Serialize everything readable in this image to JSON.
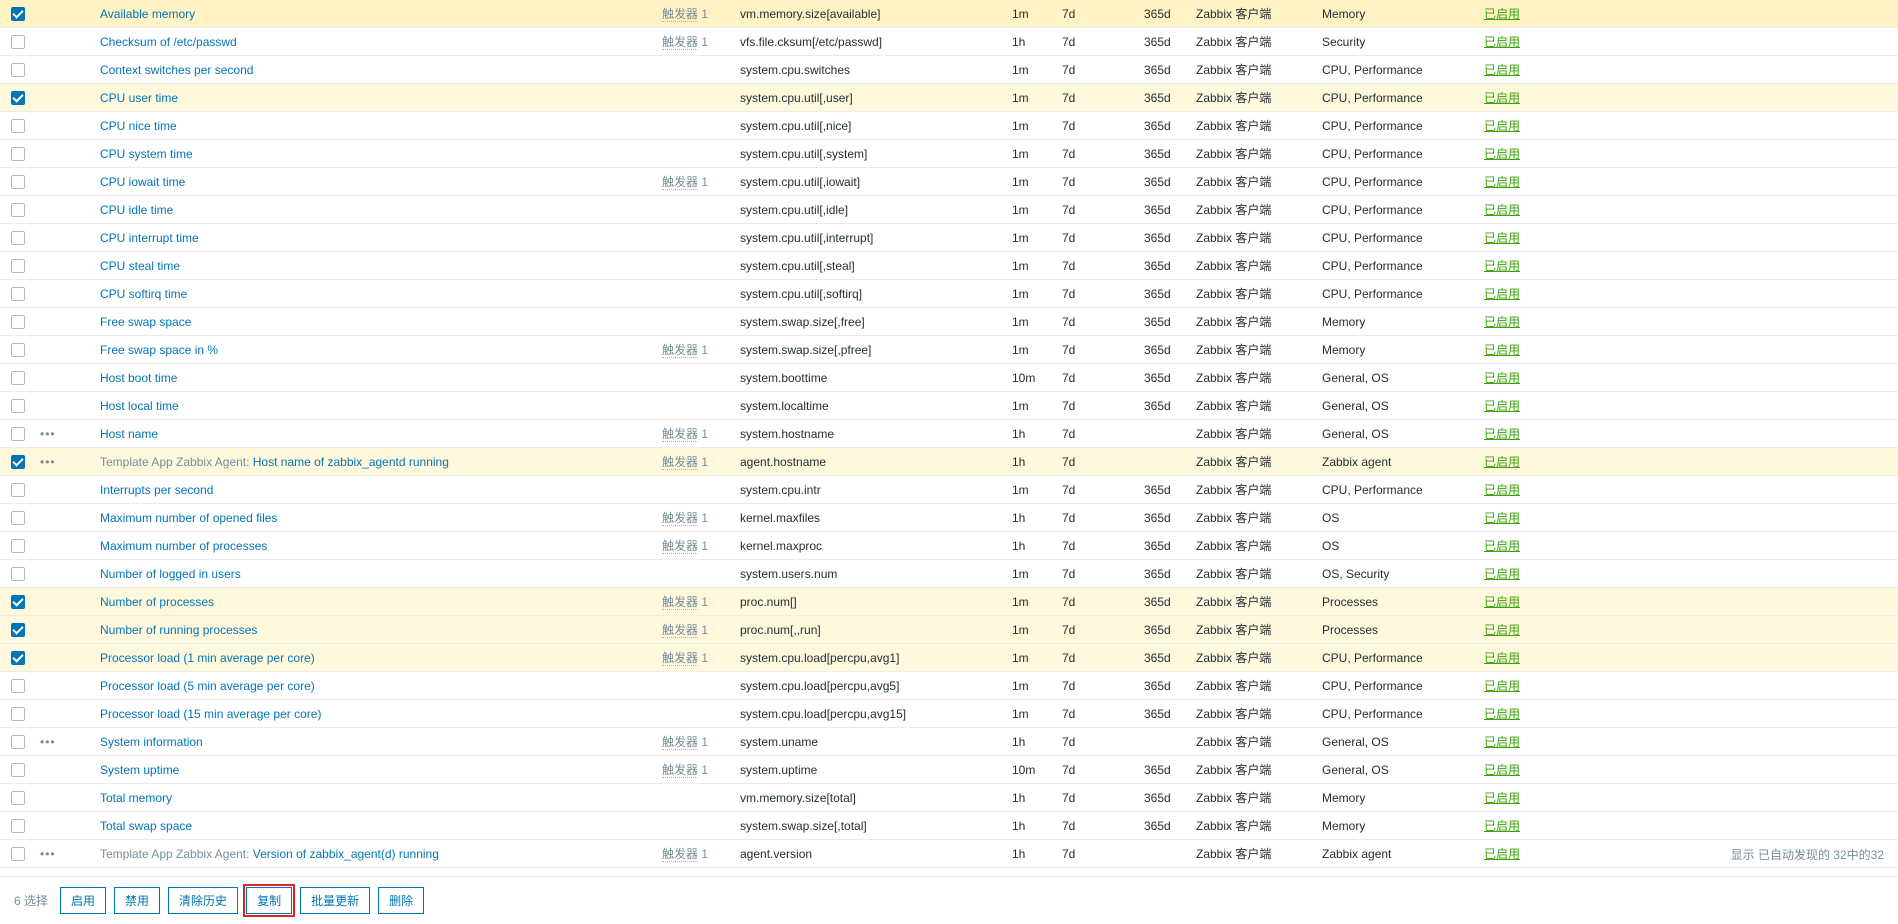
{
  "trigger_word": "触发器",
  "footer": {
    "selected_label": "6 选择",
    "enable": "启用",
    "disable": "禁用",
    "clear_history": "清除历史",
    "copy": "复制",
    "mass_update": "批量更新",
    "delete": "删除"
  },
  "summary": "显示 已自动发现的 32中的32",
  "rows": [
    {
      "checked": true,
      "wizard": "",
      "prefix": "",
      "name": "Available memory",
      "triggers": "1",
      "key": "vm.memory.size[available]",
      "interval": "1m",
      "history": "7d",
      "trends": "365d",
      "type": "Zabbix 客户端",
      "app": "Memory",
      "status": "已启用"
    },
    {
      "checked": false,
      "wizard": "",
      "prefix": "",
      "name": "Checksum of /etc/passwd",
      "triggers": "1",
      "key": "vfs.file.cksum[/etc/passwd]",
      "interval": "1h",
      "history": "7d",
      "trends": "365d",
      "type": "Zabbix 客户端",
      "app": "Security",
      "status": "已启用"
    },
    {
      "checked": false,
      "wizard": "",
      "prefix": "",
      "name": "Context switches per second",
      "triggers": "",
      "key": "system.cpu.switches",
      "interval": "1m",
      "history": "7d",
      "trends": "365d",
      "type": "Zabbix 客户端",
      "app": "CPU, Performance",
      "status": "已启用"
    },
    {
      "checked": true,
      "wizard": "",
      "prefix": "",
      "name": "CPU user time",
      "triggers": "",
      "key": "system.cpu.util[,user]",
      "interval": "1m",
      "history": "7d",
      "trends": "365d",
      "type": "Zabbix 客户端",
      "app": "CPU, Performance",
      "status": "已启用"
    },
    {
      "checked": false,
      "wizard": "",
      "prefix": "",
      "name": "CPU nice time",
      "triggers": "",
      "key": "system.cpu.util[,nice]",
      "interval": "1m",
      "history": "7d",
      "trends": "365d",
      "type": "Zabbix 客户端",
      "app": "CPU, Performance",
      "status": "已启用"
    },
    {
      "checked": false,
      "wizard": "",
      "prefix": "",
      "name": "CPU system time",
      "triggers": "",
      "key": "system.cpu.util[,system]",
      "interval": "1m",
      "history": "7d",
      "trends": "365d",
      "type": "Zabbix 客户端",
      "app": "CPU, Performance",
      "status": "已启用"
    },
    {
      "checked": false,
      "wizard": "",
      "prefix": "",
      "name": "CPU iowait time",
      "triggers": "1",
      "key": "system.cpu.util[,iowait]",
      "interval": "1m",
      "history": "7d",
      "trends": "365d",
      "type": "Zabbix 客户端",
      "app": "CPU, Performance",
      "status": "已启用"
    },
    {
      "checked": false,
      "wizard": "",
      "prefix": "",
      "name": "CPU idle time",
      "triggers": "",
      "key": "system.cpu.util[,idle]",
      "interval": "1m",
      "history": "7d",
      "trends": "365d",
      "type": "Zabbix 客户端",
      "app": "CPU, Performance",
      "status": "已启用"
    },
    {
      "checked": false,
      "wizard": "",
      "prefix": "",
      "name": "CPU interrupt time",
      "triggers": "",
      "key": "system.cpu.util[,interrupt]",
      "interval": "1m",
      "history": "7d",
      "trends": "365d",
      "type": "Zabbix 客户端",
      "app": "CPU, Performance",
      "status": "已启用"
    },
    {
      "checked": false,
      "wizard": "",
      "prefix": "",
      "name": "CPU steal time",
      "triggers": "",
      "key": "system.cpu.util[,steal]",
      "interval": "1m",
      "history": "7d",
      "trends": "365d",
      "type": "Zabbix 客户端",
      "app": "CPU, Performance",
      "status": "已启用"
    },
    {
      "checked": false,
      "wizard": "",
      "prefix": "",
      "name": "CPU softirq time",
      "triggers": "",
      "key": "system.cpu.util[,softirq]",
      "interval": "1m",
      "history": "7d",
      "trends": "365d",
      "type": "Zabbix 客户端",
      "app": "CPU, Performance",
      "status": "已启用"
    },
    {
      "checked": false,
      "wizard": "",
      "prefix": "",
      "name": "Free swap space",
      "triggers": "",
      "key": "system.swap.size[,free]",
      "interval": "1m",
      "history": "7d",
      "trends": "365d",
      "type": "Zabbix 客户端",
      "app": "Memory",
      "status": "已启用"
    },
    {
      "checked": false,
      "wizard": "",
      "prefix": "",
      "name": "Free swap space in %",
      "triggers": "1",
      "key": "system.swap.size[,pfree]",
      "interval": "1m",
      "history": "7d",
      "trends": "365d",
      "type": "Zabbix 客户端",
      "app": "Memory",
      "status": "已启用"
    },
    {
      "checked": false,
      "wizard": "",
      "prefix": "",
      "name": "Host boot time",
      "triggers": "",
      "key": "system.boottime",
      "interval": "10m",
      "history": "7d",
      "trends": "365d",
      "type": "Zabbix 客户端",
      "app": "General, OS",
      "status": "已启用"
    },
    {
      "checked": false,
      "wizard": "",
      "prefix": "",
      "name": "Host local time",
      "triggers": "",
      "key": "system.localtime",
      "interval": "1m",
      "history": "7d",
      "trends": "365d",
      "type": "Zabbix 客户端",
      "app": "General, OS",
      "status": "已启用"
    },
    {
      "checked": false,
      "wizard": "•••",
      "prefix": "",
      "name": "Host name",
      "triggers": "1",
      "key": "system.hostname",
      "interval": "1h",
      "history": "7d",
      "trends": "",
      "type": "Zabbix 客户端",
      "app": "General, OS",
      "status": "已启用"
    },
    {
      "checked": true,
      "wizard": "•••",
      "prefix": "Template App Zabbix Agent: ",
      "name": "Host name of zabbix_agentd running",
      "triggers": "1",
      "key": "agent.hostname",
      "interval": "1h",
      "history": "7d",
      "trends": "",
      "type": "Zabbix 客户端",
      "app": "Zabbix agent",
      "status": "已启用"
    },
    {
      "checked": false,
      "wizard": "",
      "prefix": "",
      "name": "Interrupts per second",
      "triggers": "",
      "key": "system.cpu.intr",
      "interval": "1m",
      "history": "7d",
      "trends": "365d",
      "type": "Zabbix 客户端",
      "app": "CPU, Performance",
      "status": "已启用"
    },
    {
      "checked": false,
      "wizard": "",
      "prefix": "",
      "name": "Maximum number of opened files",
      "triggers": "1",
      "key": "kernel.maxfiles",
      "interval": "1h",
      "history": "7d",
      "trends": "365d",
      "type": "Zabbix 客户端",
      "app": "OS",
      "status": "已启用"
    },
    {
      "checked": false,
      "wizard": "",
      "prefix": "",
      "name": "Maximum number of processes",
      "triggers": "1",
      "key": "kernel.maxproc",
      "interval": "1h",
      "history": "7d",
      "trends": "365d",
      "type": "Zabbix 客户端",
      "app": "OS",
      "status": "已启用"
    },
    {
      "checked": false,
      "wizard": "",
      "prefix": "",
      "name": "Number of logged in users",
      "triggers": "",
      "key": "system.users.num",
      "interval": "1m",
      "history": "7d",
      "trends": "365d",
      "type": "Zabbix 客户端",
      "app": "OS, Security",
      "status": "已启用"
    },
    {
      "checked": true,
      "wizard": "",
      "prefix": "",
      "name": "Number of processes",
      "triggers": "1",
      "key": "proc.num[]",
      "interval": "1m",
      "history": "7d",
      "trends": "365d",
      "type": "Zabbix 客户端",
      "app": "Processes",
      "status": "已启用"
    },
    {
      "checked": true,
      "wizard": "",
      "prefix": "",
      "name": "Number of running processes",
      "triggers": "1",
      "key": "proc.num[,,run]",
      "interval": "1m",
      "history": "7d",
      "trends": "365d",
      "type": "Zabbix 客户端",
      "app": "Processes",
      "status": "已启用"
    },
    {
      "checked": true,
      "wizard": "",
      "prefix": "",
      "name": "Processor load (1 min average per core)",
      "triggers": "1",
      "key": "system.cpu.load[percpu,avg1]",
      "interval": "1m",
      "history": "7d",
      "trends": "365d",
      "type": "Zabbix 客户端",
      "app": "CPU, Performance",
      "status": "已启用"
    },
    {
      "checked": false,
      "wizard": "",
      "prefix": "",
      "name": "Processor load (5 min average per core)",
      "triggers": "",
      "key": "system.cpu.load[percpu,avg5]",
      "interval": "1m",
      "history": "7d",
      "trends": "365d",
      "type": "Zabbix 客户端",
      "app": "CPU, Performance",
      "status": "已启用"
    },
    {
      "checked": false,
      "wizard": "",
      "prefix": "",
      "name": "Processor load (15 min average per core)",
      "triggers": "",
      "key": "system.cpu.load[percpu,avg15]",
      "interval": "1m",
      "history": "7d",
      "trends": "365d",
      "type": "Zabbix 客户端",
      "app": "CPU, Performance",
      "status": "已启用"
    },
    {
      "checked": false,
      "wizard": "•••",
      "prefix": "",
      "name": "System information",
      "triggers": "1",
      "key": "system.uname",
      "interval": "1h",
      "history": "7d",
      "trends": "",
      "type": "Zabbix 客户端",
      "app": "General, OS",
      "status": "已启用"
    },
    {
      "checked": false,
      "wizard": "",
      "prefix": "",
      "name": "System uptime",
      "triggers": "1",
      "key": "system.uptime",
      "interval": "10m",
      "history": "7d",
      "trends": "365d",
      "type": "Zabbix 客户端",
      "app": "General, OS",
      "status": "已启用"
    },
    {
      "checked": false,
      "wizard": "",
      "prefix": "",
      "name": "Total memory",
      "triggers": "",
      "key": "vm.memory.size[total]",
      "interval": "1h",
      "history": "7d",
      "trends": "365d",
      "type": "Zabbix 客户端",
      "app": "Memory",
      "status": "已启用"
    },
    {
      "checked": false,
      "wizard": "",
      "prefix": "",
      "name": "Total swap space",
      "triggers": "",
      "key": "system.swap.size[,total]",
      "interval": "1h",
      "history": "7d",
      "trends": "365d",
      "type": "Zabbix 客户端",
      "app": "Memory",
      "status": "已启用"
    },
    {
      "checked": false,
      "wizard": "•••",
      "prefix": "Template App Zabbix Agent: ",
      "name": "Version of zabbix_agent(d) running",
      "triggers": "1",
      "key": "agent.version",
      "interval": "1h",
      "history": "7d",
      "trends": "",
      "type": "Zabbix 客户端",
      "app": "Zabbix agent",
      "status": "已启用"
    }
  ]
}
